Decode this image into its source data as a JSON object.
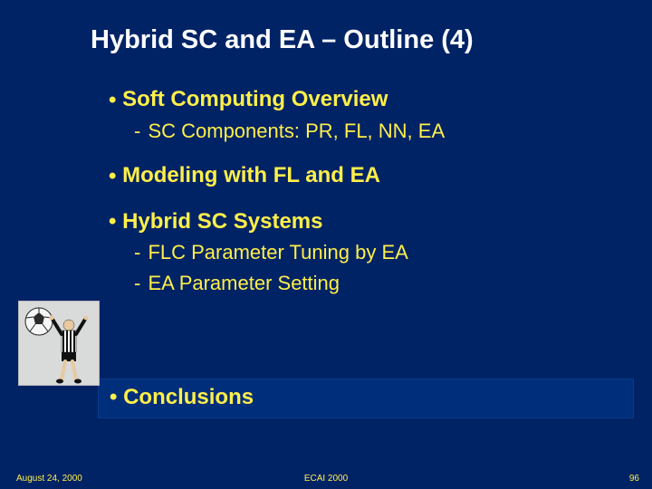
{
  "title": "Hybrid SC and EA – Outline (4)",
  "bullets": [
    {
      "label": "Soft Computing Overview",
      "subs": [
        "SC Components: PR, FL, NN, EA"
      ]
    },
    {
      "label": "Modeling with FL and EA",
      "subs": []
    },
    {
      "label": "Hybrid SC Systems",
      "subs": [
        "FLC Parameter Tuning by EA",
        "EA Parameter Setting"
      ]
    }
  ],
  "conclusions_label": "Conclusions",
  "footer": {
    "date": "August 24, 2000",
    "venue": "ECAI 2000",
    "page": "96"
  },
  "clipart_name": "referee-soccer-icon"
}
